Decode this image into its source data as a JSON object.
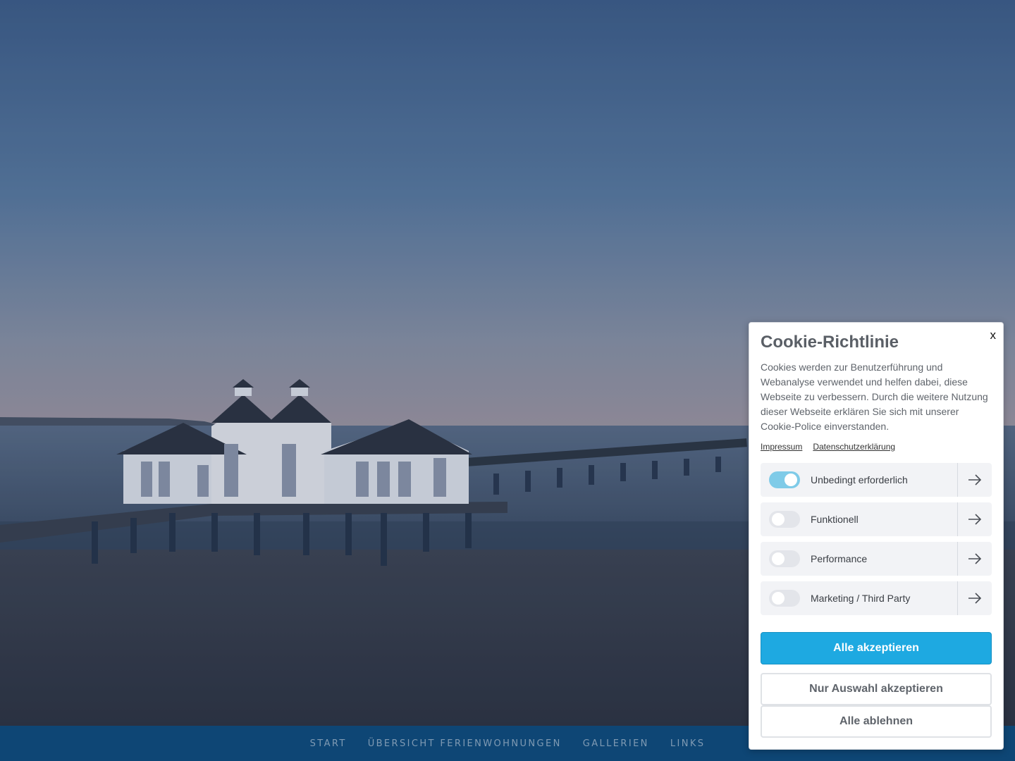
{
  "nav": {
    "items": [
      {
        "label": "START"
      },
      {
        "label": "ÜBERSICHT FERIENWOHNUNGEN"
      },
      {
        "label": "GALLERIEN"
      },
      {
        "label": "LINKS"
      }
    ]
  },
  "cookie_dialog": {
    "close_label": "x",
    "title": "Cookie-Richtlinie",
    "text": "Cookies werden zur Benutzerführung und Webanalyse verwendet und helfen dabei, diese Webseite zu verbessern. Durch die weitere Nutzung dieser Webseite erklären Sie sich mit unserer Cookie-Police einverstanden.",
    "links": {
      "impressum": "Impressum",
      "datenschutz": "Datenschutzerklärung"
    },
    "categories": [
      {
        "label": "Unbedingt erforderlich",
        "enabled": true
      },
      {
        "label": "Funktionell",
        "enabled": false
      },
      {
        "label": "Performance",
        "enabled": false
      },
      {
        "label": "Marketing / Third Party",
        "enabled": false
      }
    ],
    "buttons": {
      "accept_all": "Alle akzeptieren",
      "accept_selection": "Nur Auswahl akzeptieren",
      "reject_all": "Alle ablehnen"
    }
  },
  "colors": {
    "nav_bg": "#0e4675",
    "primary_button": "#1ea9e1",
    "toggle_on": "#7fcbe8"
  }
}
